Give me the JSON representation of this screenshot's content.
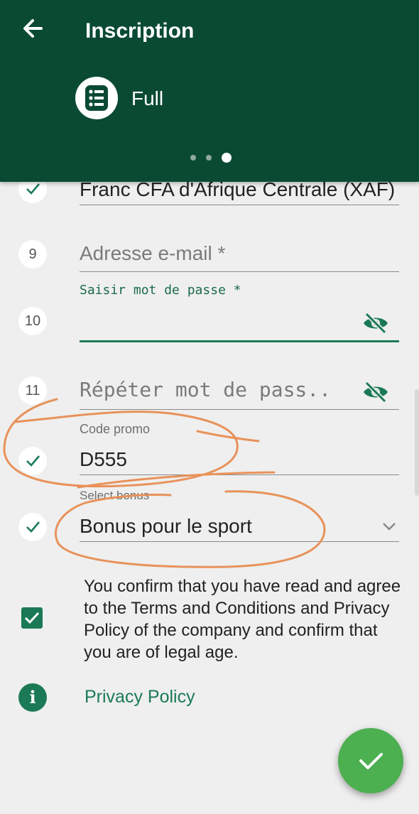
{
  "header": {
    "title": "Inscription",
    "mode_label": "Full",
    "pager_total": 3,
    "pager_active": 3,
    "color": "#0a4a33"
  },
  "form": {
    "currency": {
      "value": "Franc CFA d'Afrique Centrale (XAF)",
      "status": "checked"
    },
    "email": {
      "number": "9",
      "placeholder": "Adresse e-mail *"
    },
    "password": {
      "number": "10",
      "label": "Saisir mot de passe *",
      "value": ""
    },
    "repeat_password": {
      "number": "11",
      "placeholder": "Répéter mot de pass..."
    },
    "promo": {
      "label": "Code promo",
      "value": "D555",
      "status": "checked"
    },
    "bonus": {
      "label": "Select bonus",
      "value": "Bonus pour le sport",
      "status": "checked"
    }
  },
  "terms": {
    "text": "You confirm that you have read and agree to the Terms and Conditions and Privacy Policy of the company and confirm that you are of legal age.",
    "checked": true
  },
  "privacy_link": "Privacy Policy",
  "colors": {
    "accent": "#1b7a55",
    "fab": "#4caf50",
    "annotation": "#e8925a"
  }
}
